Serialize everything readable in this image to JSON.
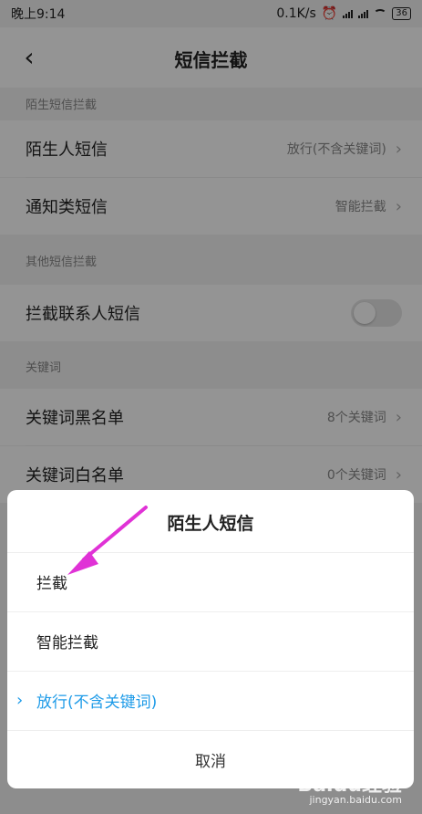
{
  "status_bar": {
    "time": "晚上9:14",
    "speed": "0.1K/s",
    "battery": "36"
  },
  "header": {
    "title": "短信拦截",
    "back_icon": "chevron-left-icon"
  },
  "sections": [
    {
      "title": "陌生短信拦截"
    },
    {
      "title": "其他短信拦截"
    },
    {
      "title": "关键词"
    }
  ],
  "rows": {
    "stranger_sms": {
      "label": "陌生人短信",
      "value": "放行(不含关键词)"
    },
    "notification_sms": {
      "label": "通知类短信",
      "value": "智能拦截"
    },
    "contact_sms": {
      "label": "拦截联系人短信",
      "enabled": false
    },
    "keyword_blacklist": {
      "label": "关键词黑名单",
      "value": "8个关键词"
    },
    "keyword_whitelist": {
      "label": "关键词白名单",
      "value": "0个关键词"
    }
  },
  "dialog": {
    "title": "陌生人短信",
    "options": [
      "拦截",
      "智能拦截",
      "放行(不含关键词)"
    ],
    "selected_index": 2,
    "cancel_label": "取消"
  },
  "watermark": {
    "text": "Baidu经验",
    "sub": "jingyan.baidu.com"
  },
  "colors": {
    "accent": "#1e9be8",
    "annotation_arrow": "#e032d6"
  }
}
